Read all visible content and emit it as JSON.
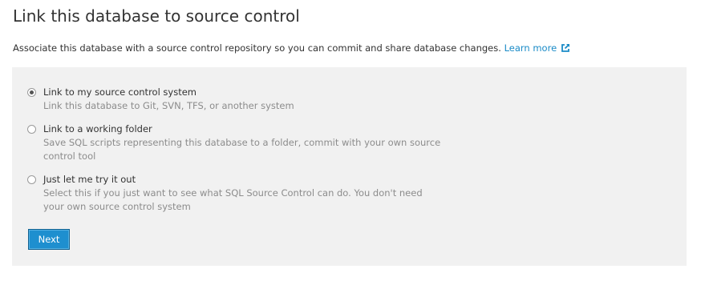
{
  "header": {
    "title": "Link this database to source control",
    "intro": "Associate this database with a source control repository so you can commit and share database changes.",
    "learn_more": "Learn more",
    "learn_more_icon": "external-link-icon"
  },
  "options": [
    {
      "label": "Link to my source control system",
      "description": "Link this database to Git, SVN, TFS, or another system",
      "selected": true
    },
    {
      "label": "Link to a working folder",
      "description": "Save SQL scripts representing this database to a folder, commit with your own source control tool",
      "selected": false
    },
    {
      "label": "Just let me try it out",
      "description": "Select this if you just want to see what SQL Source Control can do. You don't need your own source control system",
      "selected": false
    }
  ],
  "actions": {
    "next_label": "Next"
  },
  "colors": {
    "link": "#1a8bc7",
    "panel_background": "#f1f1f1",
    "button": "#1e8fcf"
  }
}
